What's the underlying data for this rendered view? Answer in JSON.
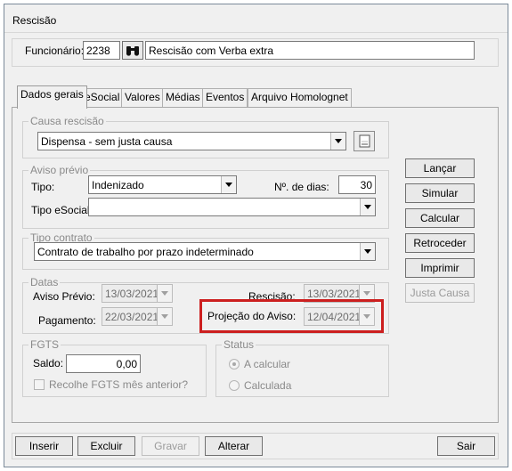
{
  "window": {
    "title": "Rescisão"
  },
  "header": {
    "funcionario_label": "Funcionário:",
    "funcionario_id": "2238",
    "funcionario_name": "Rescisão com Verba extra"
  },
  "tabs": [
    {
      "label": "Dados gerais",
      "active": true
    },
    {
      "label": "eSocial"
    },
    {
      "label": "Valores"
    },
    {
      "label": "Médias"
    },
    {
      "label": "Eventos"
    },
    {
      "label": "Arquivo Homolognet"
    }
  ],
  "causa": {
    "group_title": "Causa rescisão",
    "value": "Dispensa - sem justa causa"
  },
  "aviso": {
    "group_title": "Aviso prévio",
    "tipo_label": "Tipo:",
    "tipo_value": "Indenizado",
    "dias_label": "Nº. de dias:",
    "dias_value": "30",
    "tipo_esocial_label": "Tipo eSocial:",
    "tipo_esocial_value": ""
  },
  "contrato": {
    "group_title": "Tipo contrato",
    "value": "Contrato de trabalho por prazo indeterminado"
  },
  "datas": {
    "group_title": "Datas",
    "aviso_previo_label": "Aviso Prévio:",
    "aviso_previo_value": "13/03/2021",
    "rescisao_label": "Rescisão:",
    "rescisao_value": "13/03/2021",
    "pagamento_label": "Pagamento:",
    "pagamento_value": "22/03/2021",
    "projecao_label": "Projeção do Aviso:",
    "projecao_value": "12/04/2021"
  },
  "fgts": {
    "group_title": "FGTS",
    "saldo_label": "Saldo:",
    "saldo_value": "0,00",
    "recolhe_label": "Recolhe FGTS mês anterior?"
  },
  "status": {
    "group_title": "Status",
    "options": [
      "A calcular",
      "Calculada"
    ],
    "selected": "A calcular"
  },
  "side_buttons": [
    "Lançar",
    "Simular",
    "Calcular",
    "Retroceder",
    "Imprimir",
    "Justa Causa"
  ],
  "bottom_buttons": {
    "inserir": "Inserir",
    "excluir": "Excluir",
    "gravar": "Gravar",
    "alterar": "Alterar",
    "sair": "Sair"
  },
  "colors": {
    "highlight_box": "#cc1f1f"
  }
}
